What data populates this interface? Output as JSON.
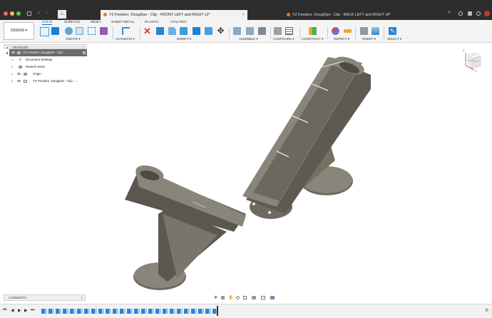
{
  "browser_tabs": [
    {
      "title": "YZ Fenders -DougDan - Clip - FRONT LEFT and RIGHT v2*",
      "active": true
    },
    {
      "title": "YZ Fenders -DougDan - Clip - BACK LEFT and RIGHT v8*",
      "active": false
    }
  ],
  "workspace": {
    "mode": "DESIGN",
    "tabs": [
      "SOLID",
      "SURFACE",
      "MESH",
      "SHEET METAL",
      "PLASTIC",
      "UTILITIES"
    ],
    "active_tab": "SOLID"
  },
  "toolbar_groups": [
    "CREATE",
    "AUTOMATE",
    "MODIFY",
    "ASSEMBLE",
    "CONFIGURE",
    "CONSTRUCT",
    "INSPECT",
    "INSERT",
    "SELECT"
  ],
  "browser_panel": {
    "title": "BROWSER",
    "items": [
      {
        "label": "YZ Fenders -DougDan - Clip...",
        "level": 0
      },
      {
        "label": "Document Settings",
        "level": 1
      },
      {
        "label": "Named Views",
        "level": 1
      },
      {
        "label": "Origin",
        "level": 1
      },
      {
        "label": "YZ Fenders -DougDan - Clip - ...",
        "level": 1
      }
    ]
  },
  "comments_label": "COMMENTS",
  "viewcube_faces": {
    "top": "TOP",
    "front": "FRONT",
    "right": "RIGHT",
    "axis_z": "Z",
    "axis_x": "X"
  },
  "colors": {
    "model": "#726e64",
    "accent": "#0a6fc2",
    "selection": "#d63b2f"
  }
}
